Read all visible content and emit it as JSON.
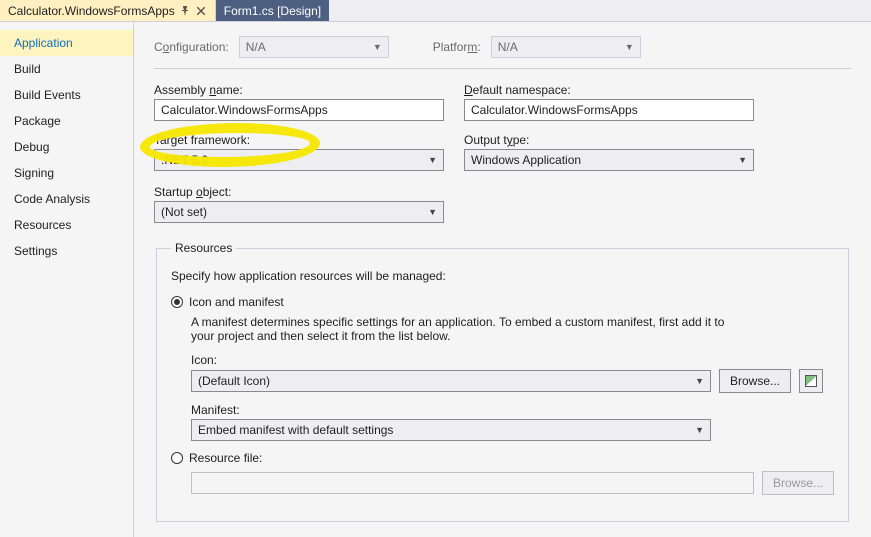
{
  "tabs": {
    "active": {
      "label": "Calculator.WindowsFormsApps"
    },
    "inactive": {
      "label": "Form1.cs [Design]"
    }
  },
  "sidebar": {
    "items": [
      "Application",
      "Build",
      "Build Events",
      "Package",
      "Debug",
      "Signing",
      "Code Analysis",
      "Resources",
      "Settings"
    ]
  },
  "toprow": {
    "config_label_pre": "C",
    "config_label_ul": "o",
    "config_label_post": "nfiguration:",
    "config_value": "N/A",
    "platform_label_pre": "Platfor",
    "platform_label_ul": "m",
    "platform_label_post": ":",
    "platform_value": "N/A"
  },
  "fields": {
    "assembly_label_pre": "Assembly ",
    "assembly_label_ul": "n",
    "assembly_label_post": "ame:",
    "assembly_value": "Calculator.WindowsFormsApps",
    "namespace_label_pre": "",
    "namespace_label_ul": "D",
    "namespace_label_post": "efault namespace:",
    "namespace_value": "Calculator.WindowsFormsApps",
    "target_label_pre": "Tar",
    "target_label_ul": "g",
    "target_label_post": "et framework:",
    "target_value": ".NET 5.0",
    "output_label_pre": "Output t",
    "output_label_ul": "y",
    "output_label_post": "pe:",
    "output_value": "Windows Application",
    "startup_label_pre": "Startup ",
    "startup_label_ul": "o",
    "startup_label_post": "bject:",
    "startup_value": "(Not set)"
  },
  "resources": {
    "legend": "Resources",
    "desc": "Specify how application resources will be managed:",
    "icon_manifest_label": "Icon and manifest",
    "manifest_desc": "A manifest determines specific settings for an application. To embed a custom manifest, first add it to your project and then select it from the list below.",
    "icon_label": "Icon:",
    "icon_value": "(Default Icon)",
    "browse1": "Browse...",
    "manifest_label": "Manifest:",
    "manifest_value": "Embed manifest with default settings",
    "resource_file_label_pre": "Resource ",
    "resource_file_label_ul": "f",
    "resource_file_label_post": "ile:",
    "browse2": "Browse..."
  }
}
